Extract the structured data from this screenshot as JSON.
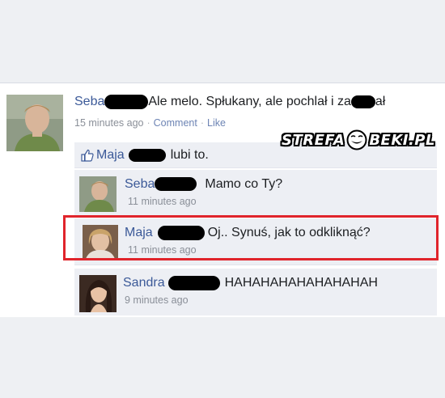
{
  "post": {
    "author": "Seba",
    "text_part1": "Ale melo. Spłukany, ale pochlał i za",
    "text_part2": "ał",
    "time": "15 minutes ago",
    "comment_label": "Comment",
    "like_label": "Like",
    "separator": "·"
  },
  "likes": {
    "name": "Maja",
    "text": "lubi to."
  },
  "comments": [
    {
      "author": "Seba",
      "text": "Mamo co Ty?",
      "time": "11 minutes ago"
    },
    {
      "author": "Maja",
      "text": "Oj.. Synuś, jak to odkliknąć?",
      "time": "11 minutes ago"
    },
    {
      "author": "Sandra",
      "text": "HAHAHAHAHAHAHAHAH",
      "time": "9 minutes ago"
    }
  ],
  "watermark": {
    "left": "STREFA",
    "right": "BEKI.PL"
  },
  "icons": {
    "like": "thumbs-up-icon",
    "watermark_face": "troll-face-icon"
  },
  "colors": {
    "link": "#3b5998",
    "highlight": "#e0242b",
    "comment_bg": "#edeff4"
  }
}
